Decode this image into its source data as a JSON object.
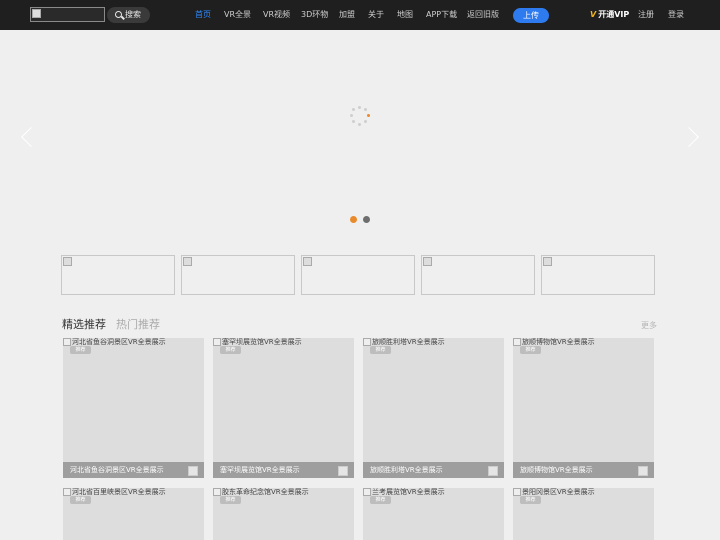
{
  "header": {
    "search_label": "搜索",
    "nav": [
      "首页",
      "VR全景",
      "VR视频",
      "3D环物",
      "加盟",
      "关于",
      "地图",
      "APP下载",
      "返回旧版"
    ],
    "upload_label": "上传",
    "vip_label": "开通VIP",
    "register_label": "注册",
    "login_label": "登录",
    "accent_color": "#2e8bff"
  },
  "banner": {
    "slide_count": 2,
    "active_dot_color": "#e98a2c"
  },
  "section": {
    "tab_active": "精选推荐",
    "tab_inactive": "热门推荐",
    "more_label": "更多"
  },
  "cards": [
    {
      "title": "河北省鱼谷洞景区VR全景展示",
      "tag": "推荐"
    },
    {
      "title": "塞罕坝展览馆VR全景展示",
      "tag": "推荐"
    },
    {
      "title": "旅顺胜利塔VR全景展示",
      "tag": "推荐"
    },
    {
      "title": "旅顺博物馆VR全景展示",
      "tag": "推荐"
    },
    {
      "title": "河北省百里峡景区VR全景展示",
      "tag": "推荐"
    },
    {
      "title": "胶东革命纪念馆VR全景展示",
      "tag": "推荐"
    },
    {
      "title": "兰考展览馆VR全景展示",
      "tag": "推荐"
    },
    {
      "title": "景阳冈景区VR全景展示",
      "tag": "推荐"
    }
  ]
}
